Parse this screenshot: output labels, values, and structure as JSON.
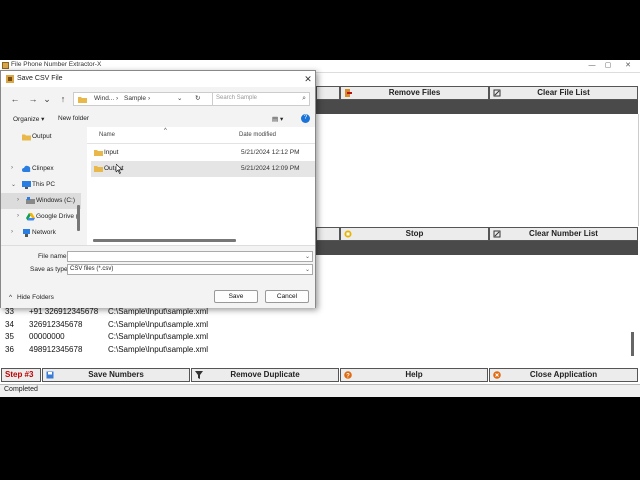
{
  "app": {
    "title": "File Phone Number Extractor-X",
    "window_controls": {
      "minimize": "—",
      "maximize": "▢",
      "close": "✕"
    },
    "top_buttons": {
      "remove_files": "Remove Files",
      "clear_file_list": "Clear File List"
    },
    "mid_buttons": {
      "stop": "Stop",
      "clear_number_list": "Clear Number List"
    },
    "results": [
      {
        "num": "33",
        "phone": "+91 326912345678",
        "file": "C:\\Sample\\Input\\sample.xml"
      },
      {
        "num": "34",
        "phone": "326912345678",
        "file": "C:\\Sample\\Input\\sample.xml"
      },
      {
        "num": "35",
        "phone": "00000000",
        "file": "C:\\Sample\\Input\\sample.xml"
      },
      {
        "num": "36",
        "phone": "498912345678",
        "file": "C:\\Sample\\Input\\sample.xml"
      }
    ],
    "bottom": {
      "step_label": "Step #3",
      "save_numbers": "Save Numbers",
      "remove_duplicate": "Remove Duplicate",
      "help": "Help",
      "close_application": "Close Application"
    },
    "status_text": "Completed",
    "colors": {
      "step_red": "#c00000",
      "dark_bar": "#4a4a4a"
    }
  },
  "dialog": {
    "title": "Save CSV File",
    "close": "✕",
    "nav": {
      "back": "←",
      "forward": "→",
      "recent": "⌄",
      "up": "↑",
      "refresh": "↻"
    },
    "breadcrumb": [
      "Wind...",
      "›",
      "Sample",
      "›"
    ],
    "address_dropdown": "⌄",
    "search_placeholder": "Search Sample",
    "search_icon": "⌕",
    "toolbar": {
      "organize": "Organize ▾",
      "new_folder": "New folder",
      "view": "▤ ▾",
      "help": "?"
    },
    "sidebar": [
      {
        "label": "Output",
        "chevron": "",
        "icon": "folder-icon"
      },
      {
        "label": "Clinpex",
        "chevron": "›",
        "icon": "cloud-icon"
      },
      {
        "label": "This PC",
        "chevron": "⌄",
        "icon": "pc-icon"
      },
      {
        "label": "Windows (C:)",
        "chevron": "›",
        "icon": "drive-icon"
      },
      {
        "label": "Google Drive (",
        "chevron": "›",
        "icon": "google-drive-icon"
      },
      {
        "label": "Network",
        "chevron": "›",
        "icon": "network-icon"
      }
    ],
    "columns": {
      "name": "Name",
      "date_modified": "Date modified",
      "sort_arrow": "^"
    },
    "files": [
      {
        "name": "Input",
        "date": "5/21/2024 12:12 PM"
      },
      {
        "name": "Output",
        "date": "5/21/2024 12:09 PM"
      }
    ],
    "file_name_label": "File name:",
    "file_name_value": "",
    "save_as_type_label": "Save as type:",
    "save_as_type_value": "CSV files (*.csv)",
    "hide_folders": "Hide Folders",
    "hide_chevron": "^",
    "save": "Save",
    "cancel": "Cancel",
    "dropdown_arrow": "⌄"
  }
}
